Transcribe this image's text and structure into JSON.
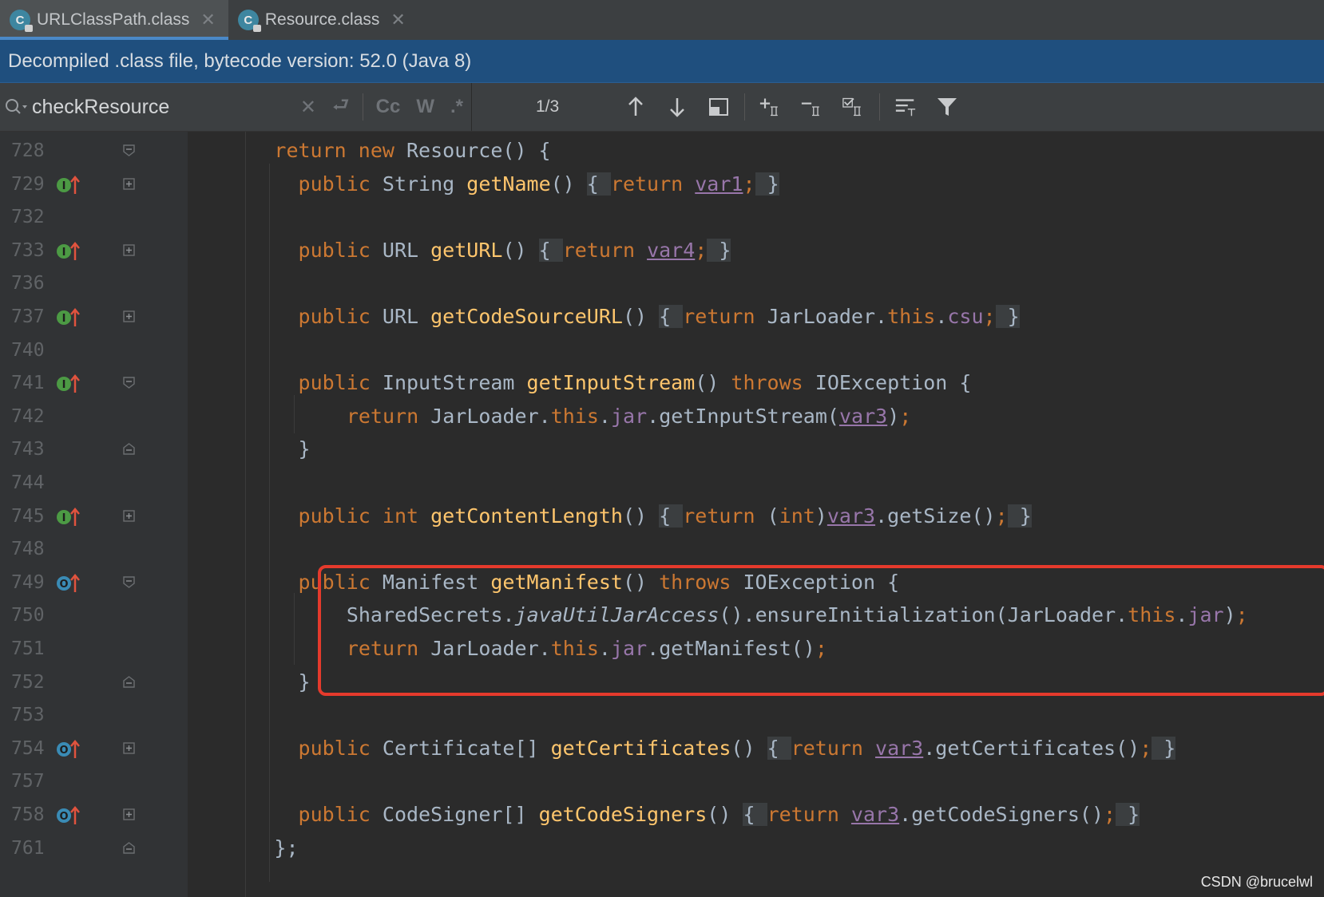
{
  "tabs": [
    {
      "label": "URLClassPath.class",
      "icon": "class-file-icon",
      "active": true
    },
    {
      "label": "Resource.class",
      "icon": "class-file-icon",
      "active": false
    }
  ],
  "banner": {
    "text": "Decompiled .class file, bytecode version: 52.0 (Java 8)"
  },
  "search": {
    "query": "checkResource",
    "match_case": "Cc",
    "words": "W",
    "regex": ".*",
    "matches": "1/3"
  },
  "code_lines": [
    {
      "num": "728",
      "marker": "",
      "fold": "open",
      "indent": 6,
      "tokens": [
        [
          "kw",
          "return "
        ],
        [
          "kw",
          "new "
        ],
        [
          "p",
          "Resource() {"
        ]
      ]
    },
    {
      "num": "729",
      "marker": "implements",
      "fold": "plus",
      "indent": 8,
      "tokens": [
        [
          "kw",
          "public "
        ],
        [
          "p",
          "String "
        ],
        [
          "fn",
          "getName"
        ],
        [
          "p",
          "() "
        ],
        [
          "fb",
          "{ "
        ],
        [
          "kw",
          "return "
        ],
        [
          "fldu",
          "var1"
        ],
        [
          "kw",
          ";"
        ],
        [
          "fb",
          " }"
        ]
      ]
    },
    {
      "num": "732",
      "marker": "",
      "fold": "",
      "indent": 0,
      "tokens": []
    },
    {
      "num": "733",
      "marker": "implements",
      "fold": "plus",
      "indent": 8,
      "tokens": [
        [
          "kw",
          "public "
        ],
        [
          "p",
          "URL "
        ],
        [
          "fn",
          "getURL"
        ],
        [
          "p",
          "() "
        ],
        [
          "fb",
          "{ "
        ],
        [
          "kw",
          "return "
        ],
        [
          "fldu",
          "var4"
        ],
        [
          "kw",
          ";"
        ],
        [
          "fb",
          " }"
        ]
      ]
    },
    {
      "num": "736",
      "marker": "",
      "fold": "",
      "indent": 0,
      "tokens": []
    },
    {
      "num": "737",
      "marker": "implements",
      "fold": "plus",
      "indent": 8,
      "tokens": [
        [
          "kw",
          "public "
        ],
        [
          "p",
          "URL "
        ],
        [
          "fn",
          "getCodeSourceURL"
        ],
        [
          "p",
          "() "
        ],
        [
          "fb",
          "{ "
        ],
        [
          "kw",
          "return "
        ],
        [
          "p",
          "JarLoader."
        ],
        [
          "kw",
          "this"
        ],
        [
          "p",
          "."
        ],
        [
          "fld",
          "csu"
        ],
        [
          "kw",
          ";"
        ],
        [
          "fb",
          " }"
        ]
      ]
    },
    {
      "num": "740",
      "marker": "",
      "fold": "",
      "indent": 0,
      "tokens": []
    },
    {
      "num": "741",
      "marker": "implements",
      "fold": "open",
      "indent": 8,
      "tokens": [
        [
          "kw",
          "public "
        ],
        [
          "p",
          "InputStream "
        ],
        [
          "fn",
          "getInputStream"
        ],
        [
          "p",
          "() "
        ],
        [
          "kw",
          "throws "
        ],
        [
          "p",
          "IOException {"
        ]
      ]
    },
    {
      "num": "742",
      "marker": "",
      "fold": "",
      "indent": 12,
      "tokens": [
        [
          "kw",
          "return "
        ],
        [
          "p",
          "JarLoader."
        ],
        [
          "kw",
          "this"
        ],
        [
          "p",
          "."
        ],
        [
          "fld",
          "jar"
        ],
        [
          "p",
          ".getInputStream("
        ],
        [
          "fldu",
          "var3"
        ],
        [
          "p",
          ")"
        ],
        [
          "kw",
          ";"
        ]
      ]
    },
    {
      "num": "743",
      "marker": "",
      "fold": "close",
      "indent": 8,
      "tokens": [
        [
          "p",
          "}"
        ]
      ]
    },
    {
      "num": "744",
      "marker": "",
      "fold": "",
      "indent": 0,
      "tokens": []
    },
    {
      "num": "745",
      "marker": "implements",
      "fold": "plus",
      "indent": 8,
      "tokens": [
        [
          "kw",
          "public "
        ],
        [
          "kw",
          "int "
        ],
        [
          "fn",
          "getContentLength"
        ],
        [
          "p",
          "() "
        ],
        [
          "fb",
          "{ "
        ],
        [
          "kw",
          "return "
        ],
        [
          "p",
          "("
        ],
        [
          "kw",
          "int"
        ],
        [
          "p",
          ")"
        ],
        [
          "fldu",
          "var3"
        ],
        [
          "p",
          ".getSize()"
        ],
        [
          "kw",
          ";"
        ],
        [
          "fb",
          " }"
        ]
      ]
    },
    {
      "num": "748",
      "marker": "",
      "fold": "",
      "indent": 0,
      "tokens": []
    },
    {
      "num": "749",
      "marker": "overrides",
      "fold": "open",
      "indent": 8,
      "tokens": [
        [
          "kw",
          "public "
        ],
        [
          "p",
          "Manifest "
        ],
        [
          "fn",
          "getManifest"
        ],
        [
          "p",
          "() "
        ],
        [
          "kw",
          "throws "
        ],
        [
          "p",
          "IOException {"
        ]
      ]
    },
    {
      "num": "750",
      "marker": "",
      "fold": "",
      "indent": 12,
      "tokens": [
        [
          "p",
          "SharedSecrets."
        ],
        [
          "it",
          "javaUtilJarAccess"
        ],
        [
          "p",
          "().ensureInitialization(JarLoader."
        ],
        [
          "kw",
          "this"
        ],
        [
          "p",
          "."
        ],
        [
          "fld",
          "jar"
        ],
        [
          "p",
          ")"
        ],
        [
          "kw",
          ";"
        ]
      ]
    },
    {
      "num": "751",
      "marker": "",
      "fold": "",
      "indent": 12,
      "tokens": [
        [
          "kw",
          "return "
        ],
        [
          "p",
          "JarLoader."
        ],
        [
          "kw",
          "this"
        ],
        [
          "p",
          "."
        ],
        [
          "fld",
          "jar"
        ],
        [
          "p",
          ".getManifest()"
        ],
        [
          "kw",
          ";"
        ]
      ]
    },
    {
      "num": "752",
      "marker": "",
      "fold": "close",
      "indent": 8,
      "tokens": [
        [
          "p",
          "}"
        ]
      ]
    },
    {
      "num": "753",
      "marker": "",
      "fold": "",
      "indent": 0,
      "tokens": []
    },
    {
      "num": "754",
      "marker": "overrides",
      "fold": "plus",
      "indent": 8,
      "tokens": [
        [
          "kw",
          "public "
        ],
        [
          "p",
          "Certificate[] "
        ],
        [
          "fn",
          "getCertificates"
        ],
        [
          "p",
          "() "
        ],
        [
          "fb",
          "{ "
        ],
        [
          "kw",
          "return "
        ],
        [
          "fldu",
          "var3"
        ],
        [
          "p",
          ".getCertificates()"
        ],
        [
          "kw",
          ";"
        ],
        [
          "fb",
          " }"
        ]
      ]
    },
    {
      "num": "757",
      "marker": "",
      "fold": "",
      "indent": 0,
      "tokens": []
    },
    {
      "num": "758",
      "marker": "overrides",
      "fold": "plus",
      "indent": 8,
      "tokens": [
        [
          "kw",
          "public "
        ],
        [
          "p",
          "CodeSigner[] "
        ],
        [
          "fn",
          "getCodeSigners"
        ],
        [
          "p",
          "() "
        ],
        [
          "fb",
          "{ "
        ],
        [
          "kw",
          "return "
        ],
        [
          "fldu",
          "var3"
        ],
        [
          "p",
          ".getCodeSigners()"
        ],
        [
          "kw",
          ";"
        ],
        [
          "fb",
          " }"
        ]
      ]
    },
    {
      "num": "761",
      "marker": "",
      "fold": "close",
      "indent": 6,
      "tokens": [
        [
          "p",
          "};"
        ]
      ]
    }
  ],
  "watermark": "CSDN @brucelwl",
  "colors": {
    "keyword": "#cc7832",
    "function": "#ffc66d",
    "field": "#9876aa",
    "text": "#a9b7c6",
    "highlight": "#e53a2c",
    "accent": "#4a88c7"
  }
}
